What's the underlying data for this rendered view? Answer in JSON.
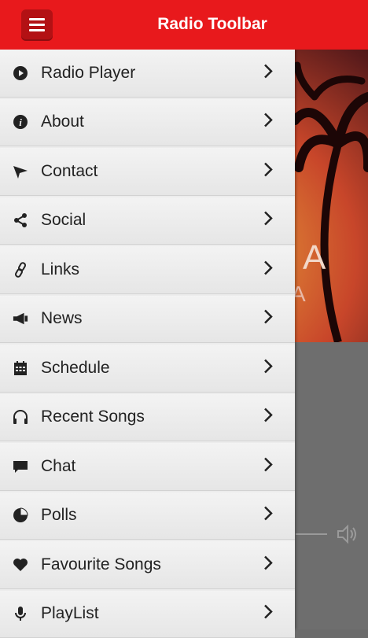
{
  "header": {
    "title": "Radio Toolbar"
  },
  "menu": {
    "items": [
      {
        "label": "Radio Player",
        "icon": "play-circle-icon"
      },
      {
        "label": "About",
        "icon": "info-icon"
      },
      {
        "label": "Contact",
        "icon": "send-icon"
      },
      {
        "label": "Social",
        "icon": "share-icon"
      },
      {
        "label": "Links",
        "icon": "link-icon"
      },
      {
        "label": "News",
        "icon": "megaphone-icon"
      },
      {
        "label": "Schedule",
        "icon": "calendar-icon"
      },
      {
        "label": "Recent Songs",
        "icon": "headphones-icon"
      },
      {
        "label": "Chat",
        "icon": "chat-icon"
      },
      {
        "label": "Polls",
        "icon": "pie-chart-icon"
      },
      {
        "label": "Favourite Songs",
        "icon": "heart-icon"
      },
      {
        "label": "PlayList",
        "icon": "microphone-icon"
      }
    ]
  },
  "background": {
    "hero_text_1": "A",
    "hero_text_2": "A"
  },
  "colors": {
    "accent": "#e8191c",
    "menu_button": "#b31114",
    "drawer_bg": "#ececec"
  }
}
